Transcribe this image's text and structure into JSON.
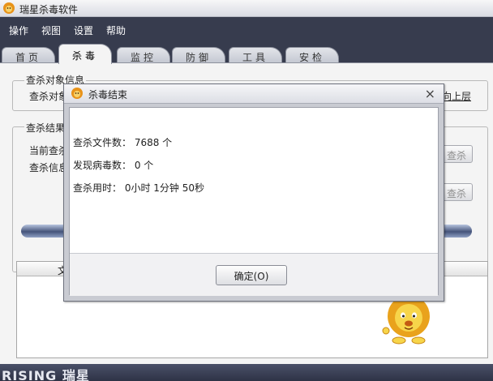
{
  "window": {
    "title": "瑞星杀毒软件"
  },
  "menu": [
    "操作",
    "视图",
    "设置",
    "帮助"
  ],
  "tabs": [
    "首页",
    "杀毒",
    "监控",
    "防御",
    "工具",
    "安检"
  ],
  "active_tab": "杀毒",
  "scan_target": {
    "group_title": "查杀对象信息",
    "label": "查杀对象",
    "up_link": "向上层"
  },
  "scan_result": {
    "group_title": "查杀结果",
    "current_label": "当前查杀",
    "info_label": "查杀信息",
    "scan_button_1": "查杀",
    "scan_button_2": "查杀"
  },
  "list": {
    "header_first": "文"
  },
  "footer": {
    "brand": "RISING 瑞星"
  },
  "dialog": {
    "title": "杀毒结束",
    "close_glyph": "×",
    "files_scanned": "查杀文件数：  7688 个",
    "viruses_found": "发现病毒数：  0 个",
    "time_used": "查杀用时：   0小时 1分钟 50秒",
    "ok_button": "确定(O)"
  },
  "colors": {
    "menubar": "#373c4e",
    "accent_orange": "#e8931a"
  }
}
